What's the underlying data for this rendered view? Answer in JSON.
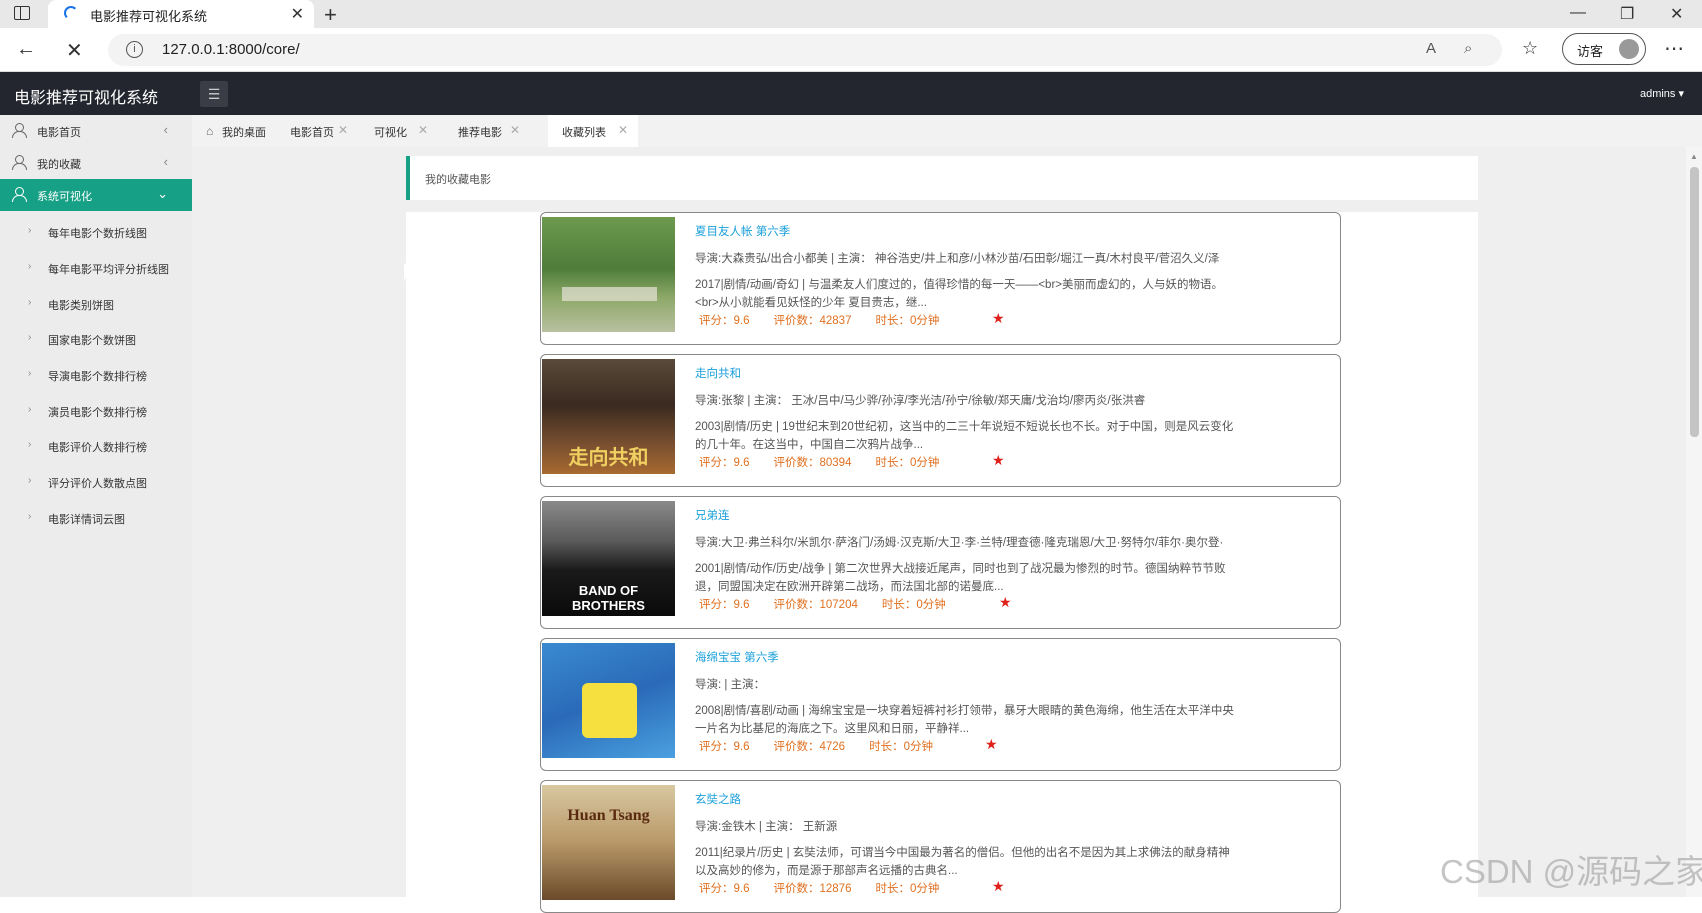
{
  "browser": {
    "tab_title": "电影推荐可视化系统",
    "url": "127.0.0.1:8000/core/",
    "guest_label": "访客"
  },
  "header": {
    "app_title": "电影推荐可视化系统",
    "user": "admins"
  },
  "sidebar": {
    "items": [
      {
        "label": "电影首页"
      },
      {
        "label": "我的收藏"
      },
      {
        "label": "系统可视化"
      }
    ],
    "sub_items": [
      {
        "label": "每年电影个数折线图"
      },
      {
        "label": "每年电影平均评分折线图"
      },
      {
        "label": "电影类别饼图"
      },
      {
        "label": "国家电影个数饼图"
      },
      {
        "label": "导演电影个数排行榜"
      },
      {
        "label": "演员电影个数排行榜"
      },
      {
        "label": "电影评价人数排行榜"
      },
      {
        "label": "评分评价人数散点图"
      },
      {
        "label": "电影详情词云图"
      }
    ]
  },
  "tabs": [
    {
      "label": "我的桌面"
    },
    {
      "label": "电影首页"
    },
    {
      "label": "可视化"
    },
    {
      "label": "推荐电影"
    },
    {
      "label": "收藏列表"
    }
  ],
  "section_title": "我的收藏电影",
  "movies": [
    {
      "title": "夏目友人帐 第六季",
      "credits": "导演:大森贵弘/出合小都美 | 主演： 神谷浩史/井上和彦/小林沙苗/石田彰/堀江一真/木村良平/菅沼久义/泽",
      "desc": "2017|剧情/动画/奇幻 | 与温柔友人们度过的，值得珍惜的每一天——<br>美丽而虚幻的，人与妖的物语。<br>从小就能看见妖怪的少年 夏目贵志，继...",
      "score": "评分：9.6",
      "count": "评价数：42837",
      "duration": "时长：0分钟"
    },
    {
      "title": "走向共和",
      "credits": "导演:张黎 | 主演： 王冰/吕中/马少骅/孙淳/李光洁/孙宁/徐敏/郑天庸/戈治均/廖丙炎/张洪睿",
      "desc": "2003|剧情/历史 | 19世纪末到20世纪初，这当中的二三十年说短不短说长也不长。对于中国，则是风云变化的几十年。在这当中，中国自二次鸦片战争...",
      "score": "评分：9.6",
      "count": "评价数：80394",
      "duration": "时长：0分钟"
    },
    {
      "title": "兄弟连",
      "credits": "导演:大卫·弗兰科尔/米凯尔·萨洛门/汤姆·汉克斯/大卫·李·兰特/理查德·隆克瑞恩/大卫·努特尔/菲尔·奥尔登·",
      "desc": "2001|剧情/动作/历史/战争 | 第二次世界大战接近尾声，同时也到了战况最为惨烈的时节。德国纳粹节节败退，同盟国决定在欧洲开辟第二战场，而法国北部的诺曼底...",
      "score": "评分：9.6",
      "count": "评价数：107204",
      "duration": "时长：0分钟"
    },
    {
      "title": "海绵宝宝 第六季",
      "credits": "导演: | 主演：",
      "desc": "2008|剧情/喜剧/动画 | 海绵宝宝是一块穿着短裤衬衫打领带，暴牙大眼睛的黄色海绵，他生活在太平洋中央一片名为比基尼的海底之下。这里风和日丽，平静祥...",
      "score": "评分：9.6",
      "count": "评价数：4726",
      "duration": "时长：0分钟"
    },
    {
      "title": "玄奘之路",
      "credits": "导演:金铁木 | 主演： 王新源",
      "desc": "2011|纪录片/历史 | 玄奘法师，可谓当今中国最为著名的僧侣。但他的出名不是因为其上求佛法的献身精神以及高妙的修为，而是源于那部声名远播的古典名...",
      "score": "评分：9.6",
      "count": "评价数：12876",
      "duration": "时长：0分钟"
    }
  ],
  "posters": [
    {
      "caption": ""
    },
    {
      "caption": "走向共和"
    },
    {
      "caption": "BAND OF BROTHERS"
    },
    {
      "caption": ""
    },
    {
      "caption": "Huan Tsang"
    }
  ],
  "watermark": "CSDN @源码之家",
  "colors": {
    "accent": "#16a085",
    "header_bg": "#23262e",
    "link": "#1a9fd9",
    "stat": "#e07020",
    "star": "#e0201a"
  }
}
